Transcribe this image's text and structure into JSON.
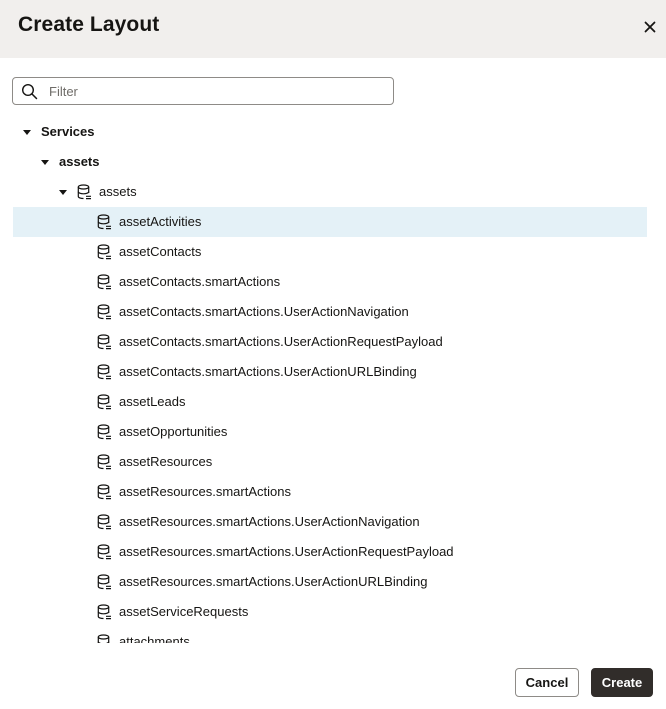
{
  "dialog": {
    "title": "Create Layout",
    "close_icon": "close-icon"
  },
  "filter": {
    "placeholder": "Filter",
    "value": "",
    "icon": "search-icon"
  },
  "tree": {
    "root": {
      "label": "Services",
      "expanded": true
    },
    "service": {
      "label": "assets",
      "expanded": true
    },
    "endpoint": {
      "label": "assets",
      "expanded": true,
      "icon": "database-icon"
    },
    "selected_index": 0,
    "children": [
      {
        "label": "assetActivities"
      },
      {
        "label": "assetContacts"
      },
      {
        "label": "assetContacts.smartActions"
      },
      {
        "label": "assetContacts.smartActions.UserActionNavigation"
      },
      {
        "label": "assetContacts.smartActions.UserActionRequestPayload"
      },
      {
        "label": "assetContacts.smartActions.UserActionURLBinding"
      },
      {
        "label": "assetLeads"
      },
      {
        "label": "assetOpportunities"
      },
      {
        "label": "assetResources"
      },
      {
        "label": "assetResources.smartActions"
      },
      {
        "label": "assetResources.smartActions.UserActionNavigation"
      },
      {
        "label": "assetResources.smartActions.UserActionRequestPayload"
      },
      {
        "label": "assetResources.smartActions.UserActionURLBinding"
      },
      {
        "label": "assetServiceRequests"
      },
      {
        "label": "attachments"
      }
    ]
  },
  "footer": {
    "cancel_label": "Cancel",
    "create_label": "Create"
  },
  "colors": {
    "header_bg": "#f1efed",
    "selected_row_bg": "#e4f1f7",
    "primary_button_bg": "#312d2a"
  }
}
